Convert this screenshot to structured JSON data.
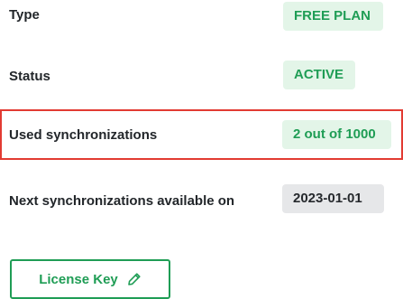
{
  "details": {
    "type": {
      "label": "Type",
      "value": "FREE PLAN"
    },
    "status": {
      "label": "Status",
      "value": "ACTIVE"
    },
    "used_synchronizations": {
      "label": "Used synchronizations",
      "value": "2 out of 1000"
    },
    "next_synchronizations": {
      "label": "Next synchronizations available on",
      "value": "2023-01-01"
    }
  },
  "license_button": {
    "label": "License Key",
    "icon": "pencil-icon"
  },
  "colors": {
    "accent_green": "#1f9d55",
    "badge_green_bg": "#e3f5e8",
    "badge_gray_bg": "#e6e7e9",
    "highlight_border": "#e23b32"
  }
}
